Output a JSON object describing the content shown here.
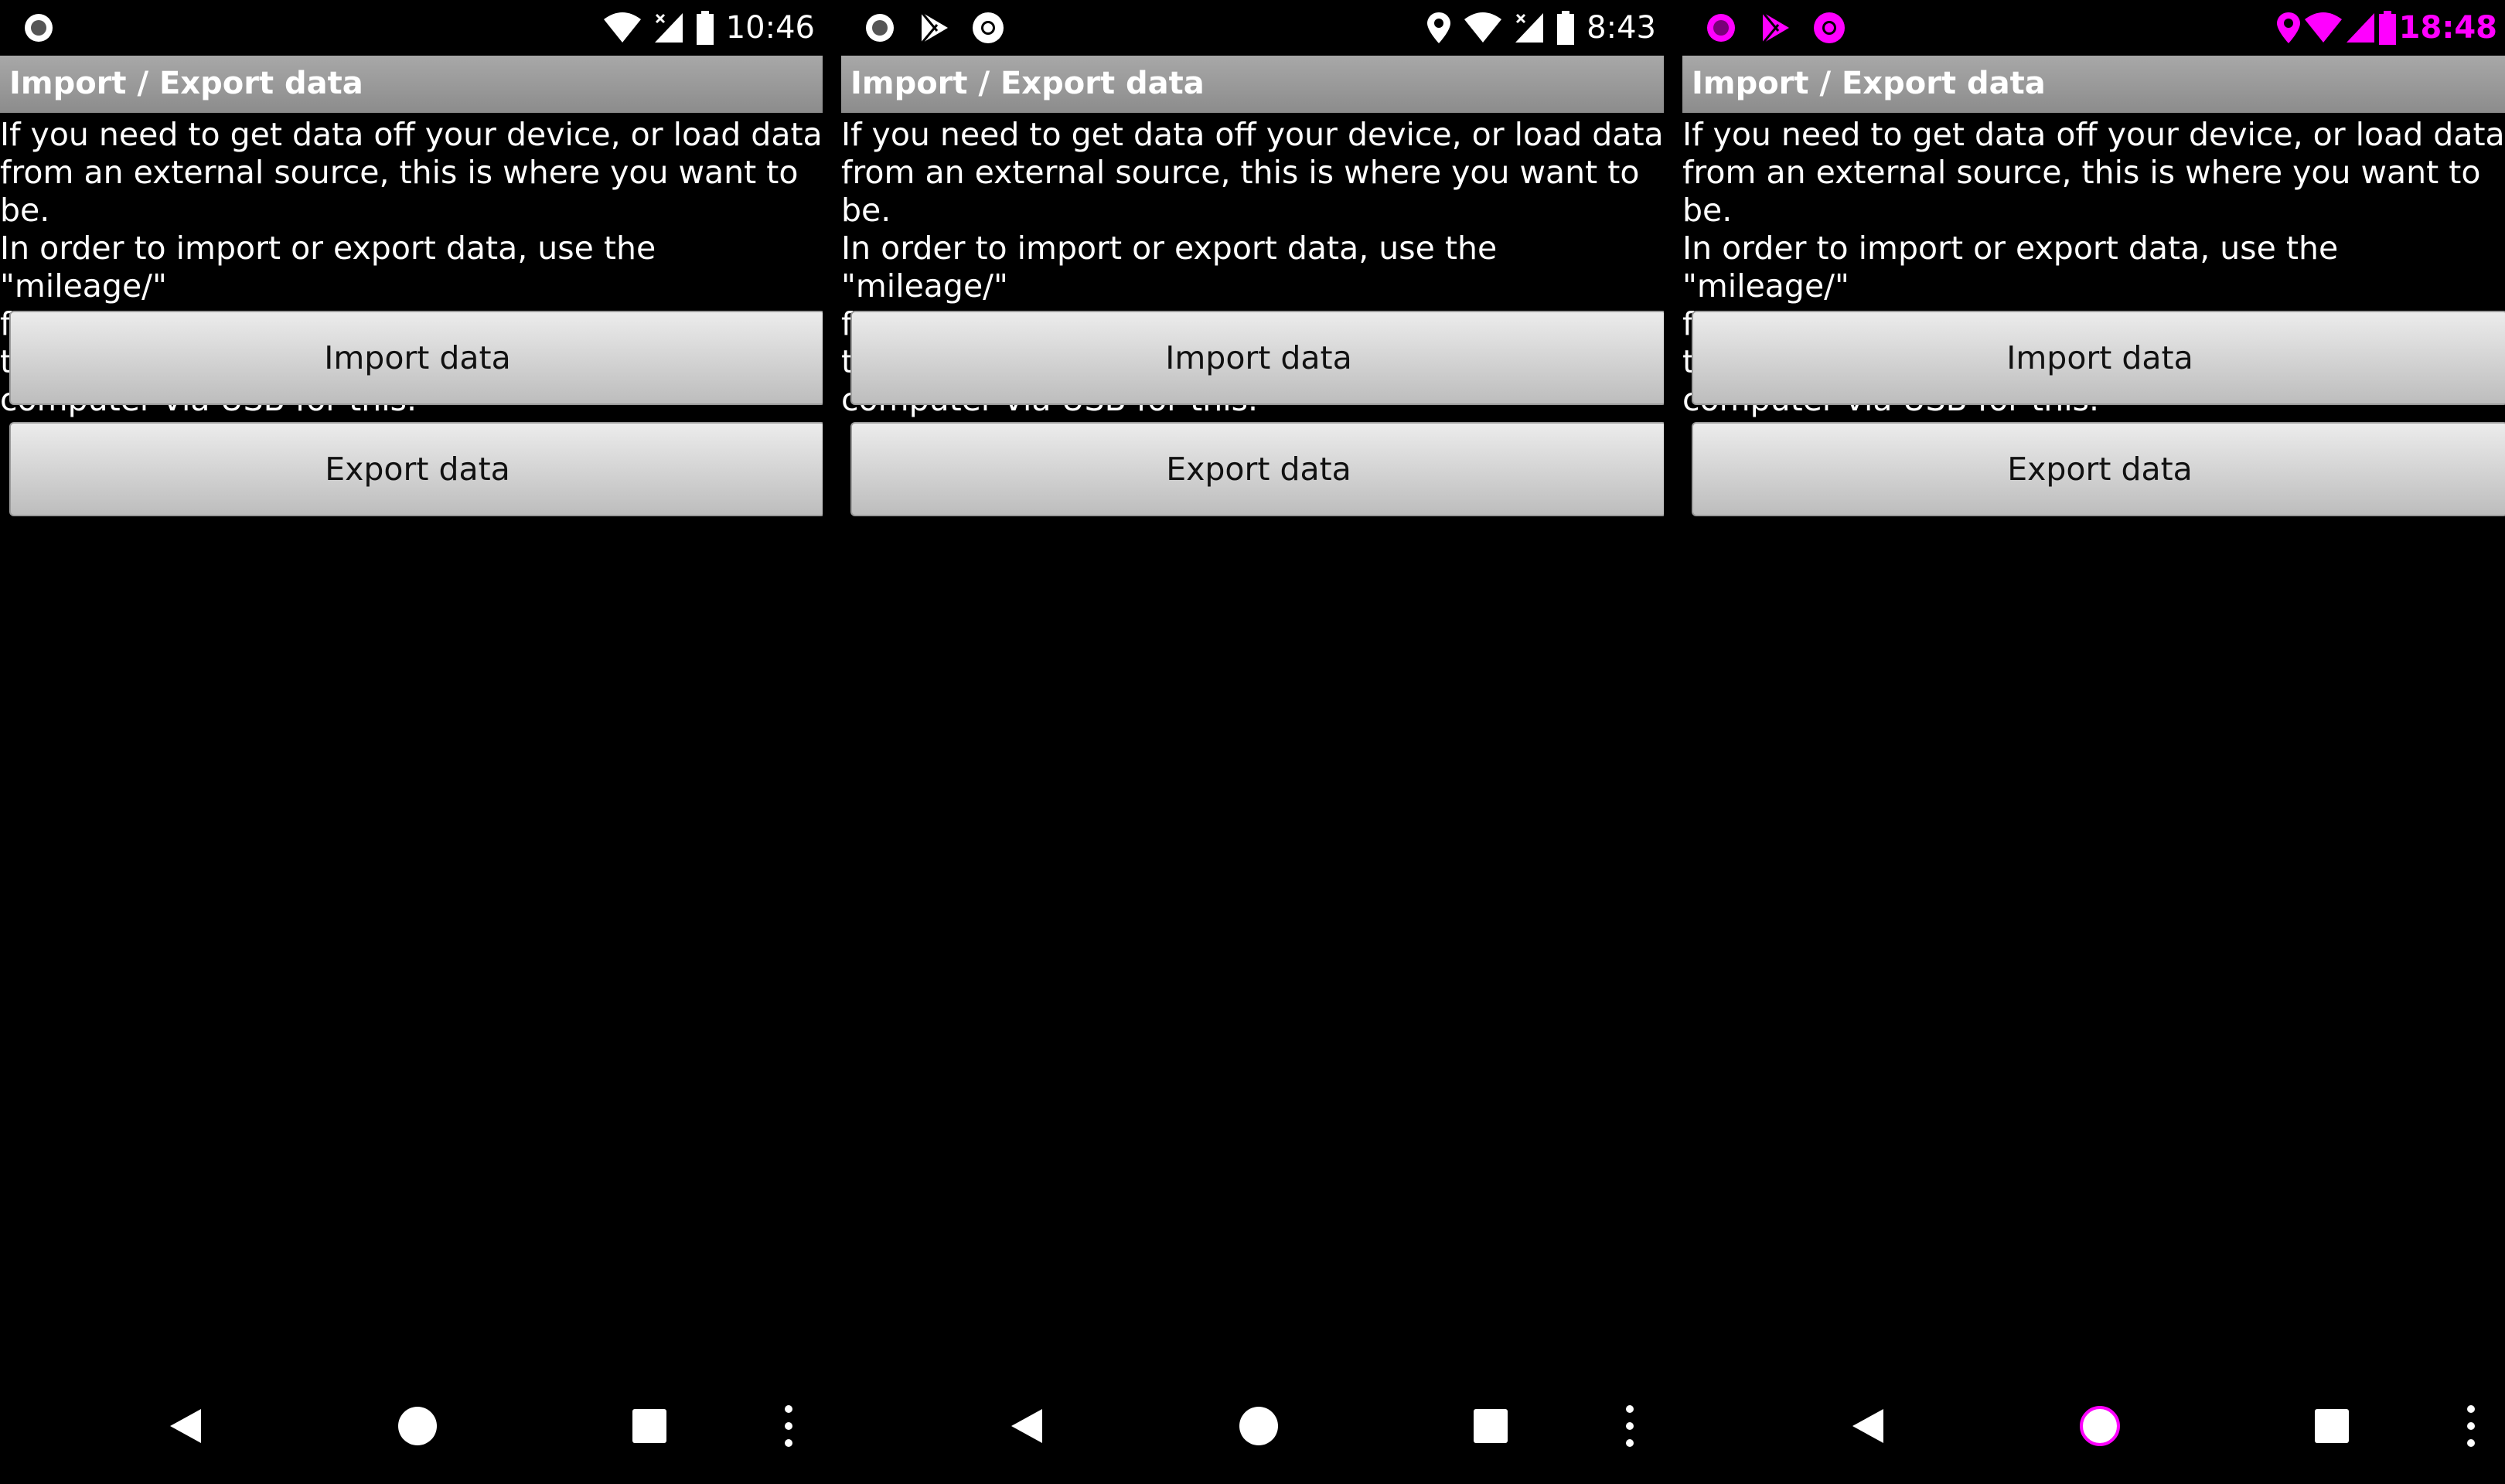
{
  "screens": [
    {
      "status": {
        "time": "10:46"
      },
      "title": "Import / Export data",
      "description": "If you need to get data off your device, or load data\nfrom an external source, this is where you want to be.\nIn order to import or export data, use the \"mileage/\"\nfolder on your device; you'll likely need to connect to your\ncomputer via USB for this.",
      "import_label": "Import data",
      "export_label": "Export data"
    },
    {
      "status": {
        "time": "8:43"
      },
      "title": "Import / Export data",
      "description": "If you need to get data off your device, or load data\nfrom an external source, this is where you want to be.\nIn order to import or export data, use the \"mileage/\"\nfolder on your device; you'll likely need to connect to your\ncomputer via USB for this.",
      "import_label": "Import data",
      "export_label": "Export data"
    },
    {
      "status": {
        "time": "18:48"
      },
      "title": "Import / Export data",
      "description": "If you need to get data off your device, or load data\nfrom an external source, this is where you want to be.\nIn order to import or export data, use the \"mileage/\"\nfolder on your device; you'll likely need to connect to your\ncomputer via USB for this.",
      "import_label": "Import data",
      "export_label": "Export data"
    }
  ],
  "icons": {
    "status_left": [
      "record-icon",
      "play-store-icon",
      "chrome-icon"
    ],
    "status_right": [
      "location-icon",
      "wifi-icon",
      "signal-icon",
      "battery-icon"
    ],
    "nav": [
      "back-icon",
      "home-icon",
      "recents-icon",
      "menu-icon"
    ]
  },
  "colors": {
    "titlebar": "#999999",
    "accent_overlay": "#ff00ff",
    "background": "#000000"
  }
}
